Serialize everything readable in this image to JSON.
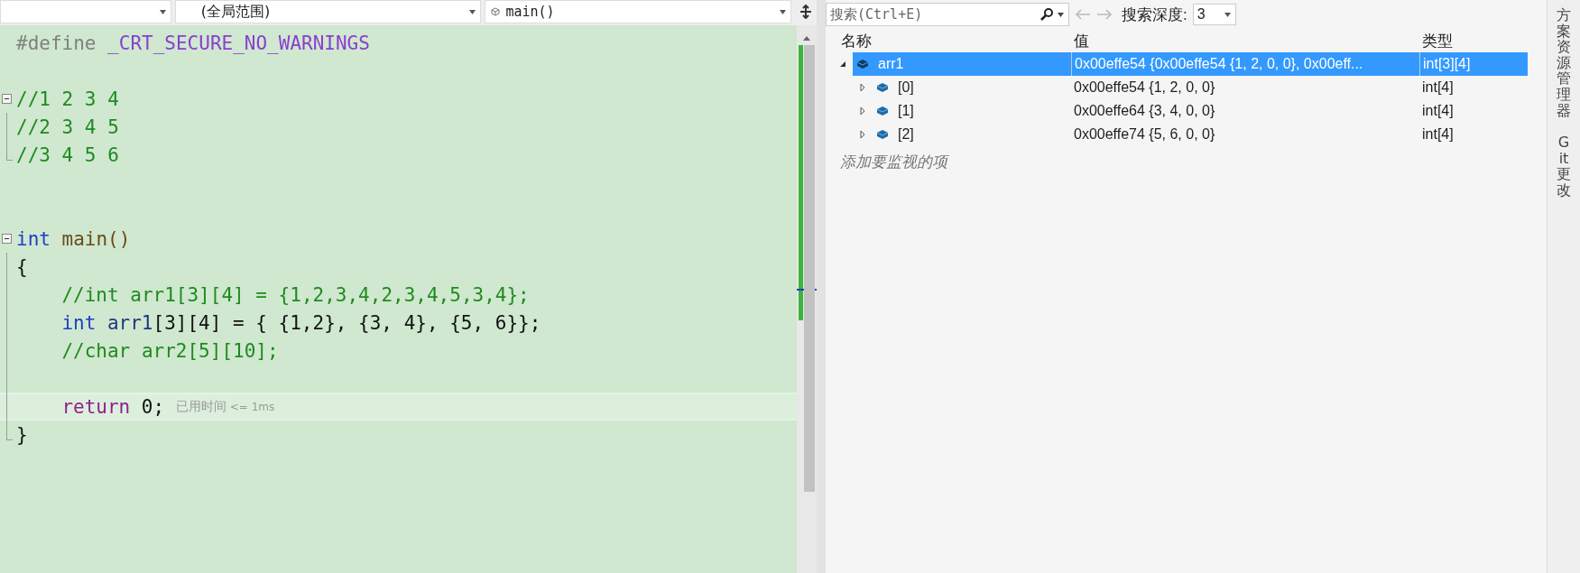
{
  "editor_toolbar": {
    "scope_dropdown": "(全局范围)",
    "function_dropdown": "main()"
  },
  "code_lines": [
    {
      "kind": "line",
      "tokens": [
        {
          "kind": "preproc",
          "text": "#define"
        },
        {
          "kind": "macro",
          "text": "_CRT_SECURE_NO_WARNINGS"
        }
      ]
    },
    {
      "kind": "line"
    },
    {
      "kind": "region",
      "expanded": true,
      "lines": [
        {
          "kind": "line",
          "tokens": [
            {
              "kind": "comment",
              "text": "//1 2 3 4"
            }
          ]
        },
        {
          "kind": "line",
          "tokens": [
            {
              "kind": "comment",
              "text": "//2 3 4 5"
            }
          ]
        },
        {
          "kind": "line",
          "tokens": [
            {
              "kind": "comment",
              "text": "//3 4 5 6"
            }
          ]
        }
      ]
    },
    {
      "kind": "line"
    },
    {
      "kind": "line"
    },
    {
      "kind": "region",
      "expanded": true,
      "lines": [
        {
          "kind": "line",
          "tokens": [
            {
              "kind": "keyword",
              "text": "int"
            },
            {
              "kind": "function",
              "text": "main()"
            }
          ]
        },
        {
          "kind": "line",
          "tokens": [
            {
              "kind": "plain",
              "text": "{"
            }
          ]
        },
        {
          "kind": "line",
          "indented": true,
          "tokens": [
            {
              "kind": "comment",
              "text": "//int arr1[3][4] = {1,2,3,4,2,3,4,5,3,4};"
            }
          ]
        },
        {
          "kind": "line",
          "indented": true,
          "tokens": [
            {
              "kind": "keyword",
              "text": "int"
            },
            {
              "kind": "variable",
              "text": "arr1"
            },
            {
              "kind": "plain",
              "text": "[3][4] = { {1,2}, {3, 4}, {5, 6}};"
            }
          ]
        },
        {
          "kind": "line",
          "indented": true,
          "tokens": [
            {
              "kind": "comment",
              "text": "//char arr2[5][10];"
            }
          ]
        },
        {
          "kind": "line"
        },
        {
          "kind": "line",
          "indented": true,
          "current": true,
          "tokens": [
            {
              "kind": "control",
              "text": "return"
            },
            {
              "kind": "plain",
              "text": "0;"
            },
            {
              "kind": "hint",
              "text": "已用时间"
            },
            {
              "kind": "hint-small",
              "text": "<= 1ms"
            }
          ]
        },
        {
          "kind": "line",
          "tokens": [
            {
              "kind": "plain",
              "text": "}"
            }
          ]
        }
      ]
    }
  ],
  "watch": {
    "search": {
      "placeholder": "搜索(Ctrl+E)"
    },
    "depth_label": "搜索深度:",
    "depth_value": "3",
    "columns": [
      "名称",
      "值",
      "类型"
    ],
    "rows": [
      {
        "name": "arr1",
        "value": "0x00effe54 {0x00effe54 {1, 2, 0, 0}, 0x00eff...",
        "type": "int[3][4]",
        "expanded": true,
        "selected": true,
        "children": [
          {
            "name": "[0]",
            "value": "0x00effe54 {1, 2, 0, 0}",
            "type": "int[4]",
            "expanded": false,
            "selected": false
          },
          {
            "name": "[1]",
            "value": "0x00effe64 {3, 4, 0, 0}",
            "type": "int[4]",
            "expanded": false,
            "selected": false
          },
          {
            "name": "[2]",
            "value": "0x00effe74 {5, 6, 0, 0}",
            "type": "int[4]",
            "expanded": false,
            "selected": false
          }
        ]
      }
    ],
    "add_item": "添加要监视的项"
  },
  "side_tabs": [
    "方案资源管理器",
    "Git 更改"
  ]
}
